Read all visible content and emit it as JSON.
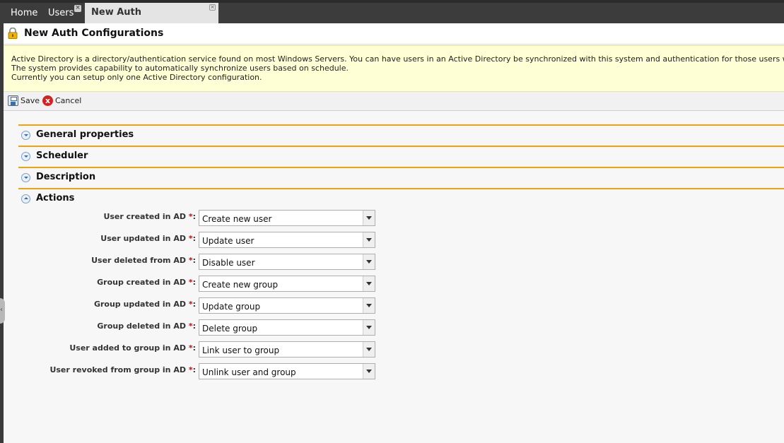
{
  "tabs": {
    "home": "Home",
    "users": "Users",
    "active": "New Auth Configurations",
    "close_glyph": "×"
  },
  "page": {
    "title": "New Auth Configurations"
  },
  "info": {
    "line1": "Active Directory is a directory/authentication service found on most Windows Servers. You can have users in an Active Directory be synchronized with this system and authentication for those users will be through the Active Dire",
    "line2": "The system provides capability to automatically synchronize users based on schedule.",
    "line3": "Currently you can setup only one Active Directory configuration."
  },
  "toolbar": {
    "save_label": "Save",
    "cancel_label": "Cancel",
    "cancel_glyph": "x"
  },
  "sections": {
    "general": "General properties",
    "scheduler": "Scheduler",
    "description": "Description",
    "actions": "Actions"
  },
  "actions": {
    "required_mark": "*",
    "rows": [
      {
        "label": "User created in AD",
        "value": "Create new user"
      },
      {
        "label": "User updated in AD",
        "value": "Update user"
      },
      {
        "label": "User deleted from AD",
        "value": "Disable user"
      },
      {
        "label": "Group created in AD",
        "value": "Create new group"
      },
      {
        "label": "Group updated in AD",
        "value": "Update group"
      },
      {
        "label": "Group deleted in AD",
        "value": "Delete group"
      },
      {
        "label": "User added to group in AD",
        "value": "Link user to group"
      },
      {
        "label": "User revoked from group in AD",
        "value": "Unlink user and group"
      }
    ]
  },
  "colors": {
    "accent_orange": "#f0a30a",
    "info_background": "#ffffd6",
    "tabbar": "#3c3c3c",
    "required": "#e00000"
  }
}
